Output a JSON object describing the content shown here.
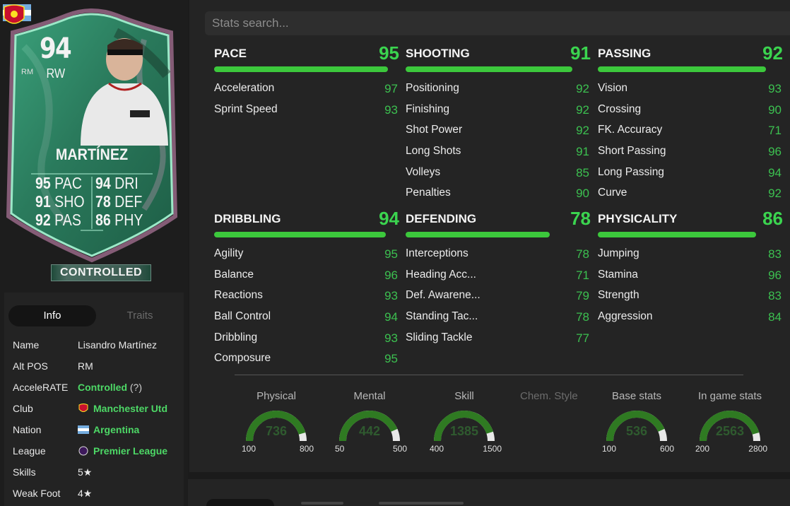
{
  "card": {
    "rating": "94",
    "position": "RW",
    "alt_position": "RM",
    "name": "MARTÍNEZ",
    "stats": [
      {
        "value": "95",
        "label": "PAC"
      },
      {
        "value": "94",
        "label": "DRI"
      },
      {
        "value": "91",
        "label": "SHO"
      },
      {
        "value": "78",
        "label": "DEF"
      },
      {
        "value": "92",
        "label": "PAS"
      },
      {
        "value": "86",
        "label": "PHY"
      }
    ],
    "badge": "CONTROLLED",
    "colors": {
      "frame": "#7fcfb0",
      "glow": "#e8a0c8",
      "body": "#2e8a66"
    }
  },
  "info": {
    "tabs": [
      {
        "label": "Info"
      },
      {
        "label": "Traits"
      }
    ],
    "rows": [
      {
        "key": "Name",
        "value": "Lisandro Martínez"
      },
      {
        "key": "Alt POS",
        "value": "RM"
      },
      {
        "key": "AcceleRATE",
        "value": "Controlled",
        "extra": "(?)"
      },
      {
        "key": "Club",
        "value": "Manchester Utd",
        "icon": "club-crest-icon"
      },
      {
        "key": "Nation",
        "value": "Argentina",
        "icon": "argentina-flag-icon"
      },
      {
        "key": "League",
        "value": "Premier League",
        "icon": "league-logo-icon"
      },
      {
        "key": "Skills",
        "value": "5★"
      },
      {
        "key": "Weak Foot",
        "value": "4★"
      }
    ]
  },
  "search": {
    "placeholder": "Stats search..."
  },
  "groups": [
    {
      "title": "PACE",
      "score": "95",
      "bar": 0.95,
      "items": [
        {
          "name": "Acceleration",
          "value": "97"
        },
        {
          "name": "Sprint Speed",
          "value": "93"
        }
      ]
    },
    {
      "title": "SHOOTING",
      "score": "91",
      "bar": 0.91,
      "items": [
        {
          "name": "Positioning",
          "value": "92"
        },
        {
          "name": "Finishing",
          "value": "92"
        },
        {
          "name": "Shot Power",
          "value": "92"
        },
        {
          "name": "Long Shots",
          "value": "91"
        },
        {
          "name": "Volleys",
          "value": "85"
        },
        {
          "name": "Penalties",
          "value": "90"
        }
      ]
    },
    {
      "title": "PASSING",
      "score": "92",
      "bar": 0.92,
      "items": [
        {
          "name": "Vision",
          "value": "93"
        },
        {
          "name": "Crossing",
          "value": "90"
        },
        {
          "name": "FK. Accuracy",
          "value": "71"
        },
        {
          "name": "Short Passing",
          "value": "96"
        },
        {
          "name": "Long Passing",
          "value": "94"
        },
        {
          "name": "Curve",
          "value": "92"
        }
      ]
    },
    {
      "title": "DRIBBLING",
      "score": "94",
      "bar": 0.94,
      "items": [
        {
          "name": "Agility",
          "value": "95"
        },
        {
          "name": "Balance",
          "value": "96"
        },
        {
          "name": "Reactions",
          "value": "93"
        },
        {
          "name": "Ball Control",
          "value": "94"
        },
        {
          "name": "Dribbling",
          "value": "93"
        },
        {
          "name": "Composure",
          "value": "95"
        }
      ]
    },
    {
      "title": "DEFENDING",
      "score": "78",
      "bar": 0.78,
      "items": [
        {
          "name": "Interceptions",
          "value": "78"
        },
        {
          "name": "Heading Acc...",
          "value": "71"
        },
        {
          "name": "Def. Awarene...",
          "value": "79"
        },
        {
          "name": "Standing Tac...",
          "value": "78"
        },
        {
          "name": "Sliding Tackle",
          "value": "77"
        }
      ]
    },
    {
      "title": "PHYSICALITY",
      "score": "86",
      "bar": 0.86,
      "items": [
        {
          "name": "Jumping",
          "value": "83"
        },
        {
          "name": "Stamina",
          "value": "96"
        },
        {
          "name": "Strength",
          "value": "83"
        },
        {
          "name": "Aggression",
          "value": "84"
        }
      ]
    }
  ],
  "gauges": [
    {
      "label": "Physical",
      "value": "736",
      "min": "100",
      "max": "800",
      "fill": 0.91
    },
    {
      "label": "Mental",
      "value": "442",
      "min": "50",
      "max": "500",
      "fill": 0.87
    },
    {
      "label": "Skill",
      "value": "1385",
      "min": "400",
      "max": "1500",
      "fill": 0.9
    },
    {
      "label": "Base stats",
      "value": "536",
      "min": "100",
      "max": "600",
      "fill": 0.87
    },
    {
      "label": "In game stats",
      "value": "2563",
      "min": "200",
      "max": "2800",
      "fill": 0.91
    }
  ],
  "chem_style": "Chem. Style",
  "colors": {
    "accent": "#3cc83c",
    "green_text": "#4dd866",
    "panel": "#242424",
    "background": "#1b1b1b"
  }
}
